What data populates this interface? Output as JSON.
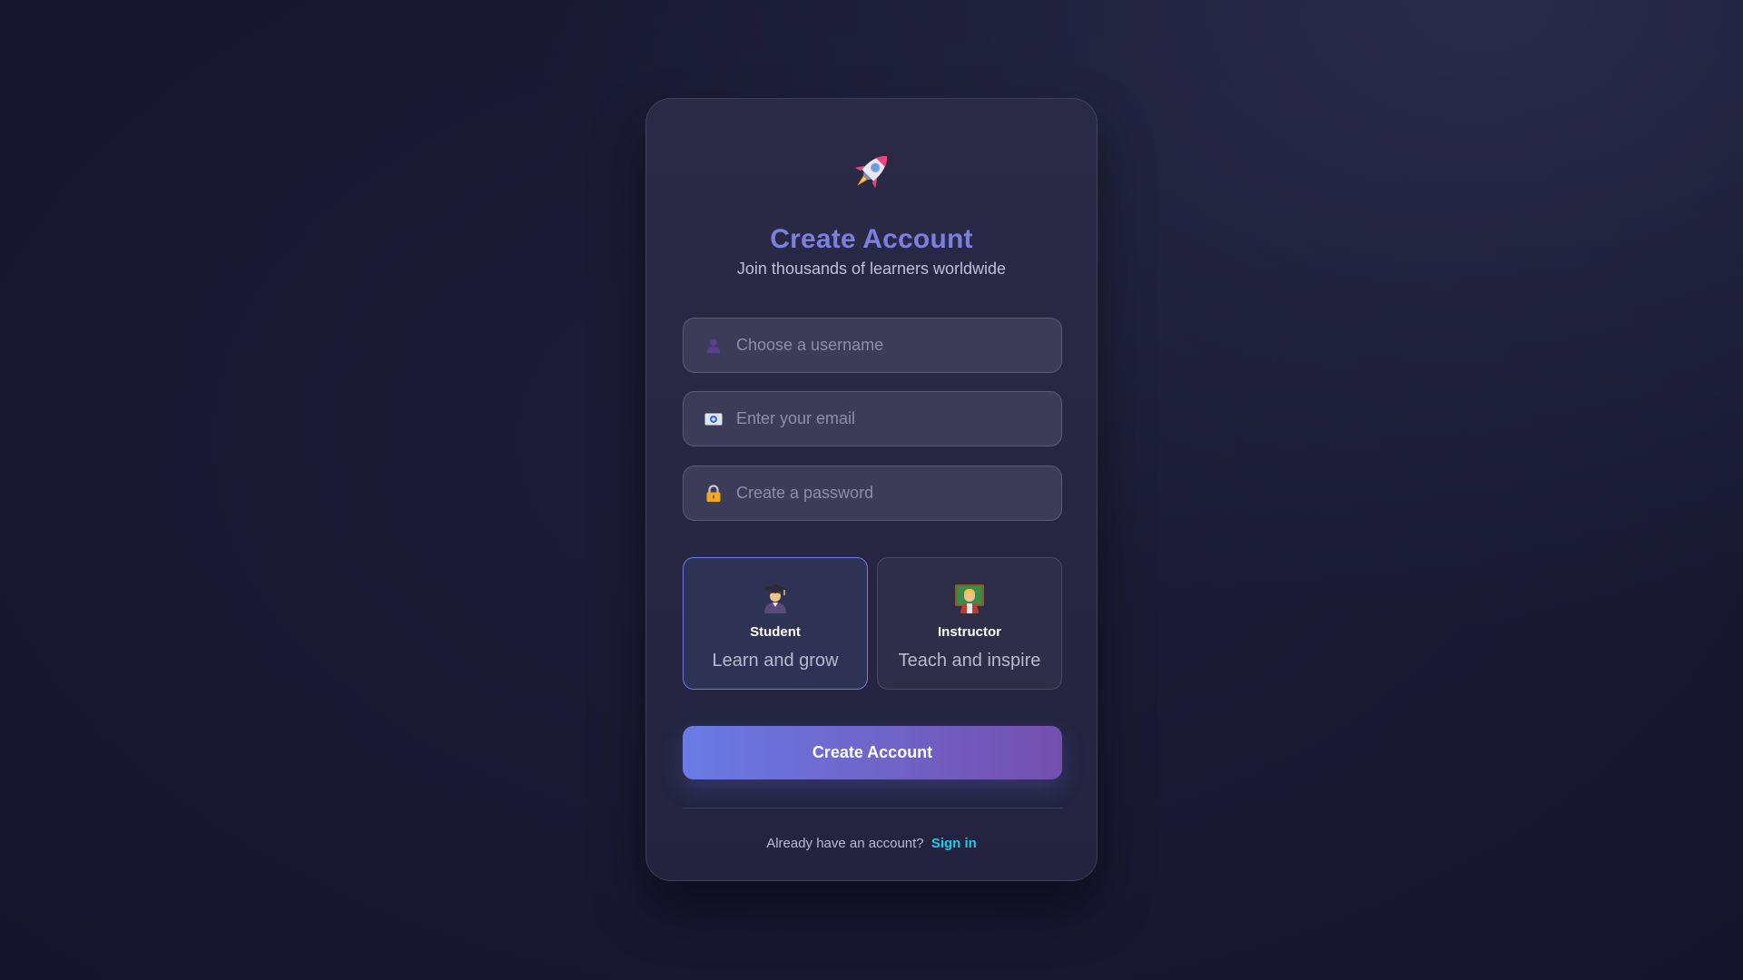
{
  "header": {
    "logo_icon": "rocket-icon",
    "title": "Create Account",
    "subtitle": "Join thousands of learners worldwide"
  },
  "form": {
    "username": {
      "icon": "user-icon",
      "placeholder": "Choose a username",
      "value": ""
    },
    "email": {
      "icon": "email-icon",
      "placeholder": "Enter your email",
      "value": ""
    },
    "password": {
      "icon": "lock-icon",
      "placeholder": "Create a password",
      "value": ""
    }
  },
  "roles": [
    {
      "icon": "student-icon",
      "title": "Student",
      "description": "Learn and grow",
      "selected": true
    },
    {
      "icon": "teacher-icon",
      "title": "Instructor",
      "description": "Teach and inspire",
      "selected": false
    }
  ],
  "submit_label": "Create Account",
  "footer": {
    "prompt": "Already have an account?",
    "link_label": "Sign in"
  },
  "colors": {
    "accent": "#7b7fe0",
    "button_start": "#6a7be6",
    "button_end": "#744fae",
    "link": "#22c8e8"
  }
}
